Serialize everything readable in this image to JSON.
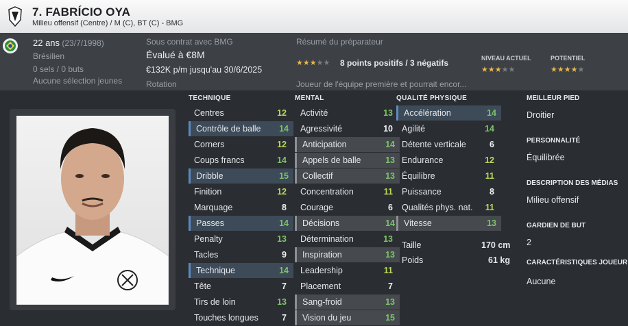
{
  "header": {
    "name": "7. FABRÍCIO OYA",
    "positions": "Milieu offensif (Centre) / M (C), BT (C) - BMG"
  },
  "info": {
    "age": "22 ans",
    "dob": "(23/7/1998)",
    "nationality": "Brésilien",
    "caps": "0 sels / 0 buts",
    "youth": "Aucune sélection jeunes",
    "contract_label": "Sous contrat avec BMG",
    "value": "Évalué à €8M",
    "wage": "€132K p/m jusqu'au 30/6/2025",
    "role": "Rotation",
    "coach_label": "Résumé du préparateur",
    "coach_stars": 3,
    "coach_summary": "8 points positifs / 3 négatifs",
    "coach_note": "Joueur de l'équipe première et pourrait encor...",
    "current_label": "NIVEAU ACTUEL",
    "current_stars": 3,
    "potential_label": "POTENTIEL",
    "potential_stars": 4
  },
  "technique": {
    "title": "TECHNIQUE",
    "rows": [
      {
        "label": "Centres",
        "value": "12"
      },
      {
        "label": "Contrôle de balle",
        "value": "14"
      },
      {
        "label": "Corners",
        "value": "12"
      },
      {
        "label": "Coups francs",
        "value": "14"
      },
      {
        "label": "Dribble",
        "value": "15"
      },
      {
        "label": "Finition",
        "value": "12"
      },
      {
        "label": "Marquage",
        "value": "8"
      },
      {
        "label": "Passes",
        "value": "14"
      },
      {
        "label": "Penalty",
        "value": "13"
      },
      {
        "label": "Tacles",
        "value": "9"
      },
      {
        "label": "Technique",
        "value": "14"
      },
      {
        "label": "Tête",
        "value": "7"
      },
      {
        "label": "Tirs de loin",
        "value": "13"
      },
      {
        "label": "Touches longues",
        "value": "7"
      }
    ]
  },
  "mental": {
    "title": "MENTAL",
    "rows": [
      {
        "label": "Activité",
        "value": "13"
      },
      {
        "label": "Agressivité",
        "value": "10"
      },
      {
        "label": "Anticipation",
        "value": "14"
      },
      {
        "label": "Appels de balle",
        "value": "13"
      },
      {
        "label": "Collectif",
        "value": "13"
      },
      {
        "label": "Concentration",
        "value": "11"
      },
      {
        "label": "Courage",
        "value": "6"
      },
      {
        "label": "Décisions",
        "value": "14"
      },
      {
        "label": "Détermination",
        "value": "13"
      },
      {
        "label": "Inspiration",
        "value": "13"
      },
      {
        "label": "Leadership",
        "value": "11"
      },
      {
        "label": "Placement",
        "value": "7"
      },
      {
        "label": "Sang-froid",
        "value": "13"
      },
      {
        "label": "Vision du jeu",
        "value": "15"
      }
    ]
  },
  "physical": {
    "title": "QUALITÉ PHYSIQUE",
    "rows": [
      {
        "label": "Accélération",
        "value": "14"
      },
      {
        "label": "Agilité",
        "value": "14"
      },
      {
        "label": "Détente verticale",
        "value": "6"
      },
      {
        "label": "Endurance",
        "value": "12"
      },
      {
        "label": "Équilibre",
        "value": "11"
      },
      {
        "label": "Puissance",
        "value": "8"
      },
      {
        "label": "Qualités phys. nat.",
        "value": "11"
      },
      {
        "label": "Vitesse",
        "value": "13"
      }
    ],
    "height_label": "Taille",
    "height": "170 cm",
    "weight_label": "Poids",
    "weight": "61 kg"
  },
  "side": {
    "foot_label": "MEILLEUR PIED",
    "foot": "Droitier",
    "personality_label": "PERSONNALITÉ",
    "personality": "Équilibrée",
    "media_label": "DESCRIPTION DES MÉDIAS",
    "media": "Milieu offensif",
    "gk_label": "GARDIEN DE BUT",
    "gk": "2",
    "traits_label": "CARACTÉRISTIQUES JOUEUR",
    "traits": "Aucune"
  },
  "colors": {
    "accent": "#5b8bc0",
    "green": "#7cc36a",
    "lime": "#b9d95a",
    "star": "#e8b84a"
  }
}
